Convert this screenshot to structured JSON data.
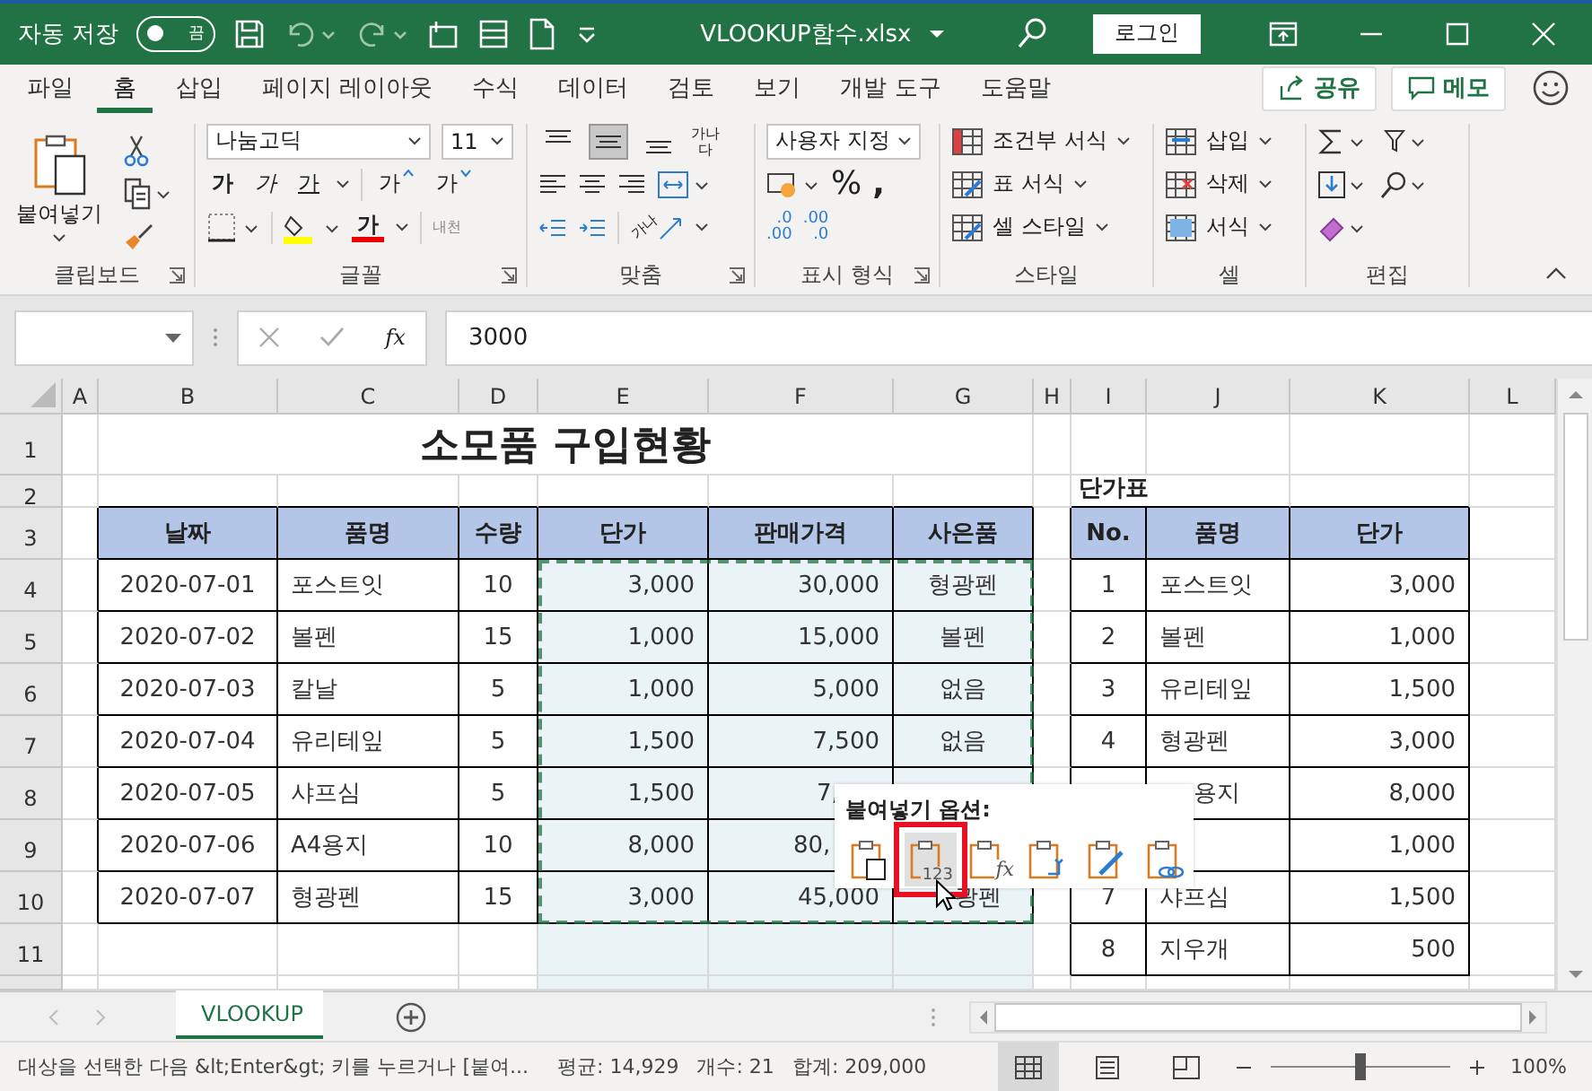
{
  "title_bar": {
    "autosave_label": "자동 저장",
    "autosave_state": "끔",
    "autosave_on": false,
    "file_name": "VLOOKUP함수.xlsx",
    "sign_in": "로그인"
  },
  "ribbon_tabs": [
    {
      "label": "파일",
      "selected": false
    },
    {
      "label": "홈",
      "selected": true
    },
    {
      "label": "삽입",
      "selected": false
    },
    {
      "label": "페이지 레이아웃",
      "selected": false
    },
    {
      "label": "수식",
      "selected": false
    },
    {
      "label": "데이터",
      "selected": false
    },
    {
      "label": "검토",
      "selected": false
    },
    {
      "label": "보기",
      "selected": false
    },
    {
      "label": "개발 도구",
      "selected": false
    },
    {
      "label": "도움말",
      "selected": false
    }
  ],
  "share": "공유",
  "comments": "메모",
  "ribbon": {
    "clipboard": {
      "paste": "붙여넣기",
      "label": "클립보드"
    },
    "font": {
      "font_name": "나눔고딕",
      "font_size": "11",
      "style_buttons": [
        {
          "kind": "bold",
          "glyph": "가"
        },
        {
          "kind": "italic",
          "glyph": "가"
        },
        {
          "kind": "underline",
          "glyph": "가"
        }
      ],
      "size_buttons": [
        {
          "kind": "grow",
          "glyph": "가"
        },
        {
          "kind": "shrink",
          "glyph": "가"
        }
      ],
      "font_color_glyph": "가",
      "phonetic_glyph": "내천",
      "label": "글꼴"
    },
    "alignment": {
      "vertical_buttons": [
        {
          "kind": "top",
          "selected": false
        },
        {
          "kind": "middle",
          "selected": true
        },
        {
          "kind": "bottom",
          "selected": false
        }
      ],
      "wrap_glyph": "가나다",
      "orientation_glyph": "가나",
      "label": "맞춤"
    },
    "number": {
      "format": "사용자 지정",
      "percent": "%",
      "comma": ",",
      "decimal_increase": [
        ".0",
        ".00"
      ],
      "decimal_decrease": [
        ".00",
        ".0"
      ],
      "label": "표시 형식"
    },
    "styles": {
      "items": [
        "조건부 서식",
        "표 서식",
        "셀 스타일"
      ],
      "label": "스타일"
    },
    "cells": {
      "items": [
        "삽입",
        "삭제",
        "서식"
      ],
      "label": "셀"
    },
    "editing": {
      "label": "편집"
    }
  },
  "formula_bar": {
    "function_symbol": "fx",
    "value": "3000"
  },
  "sheet": {
    "column_letters": [
      "A",
      "B",
      "C",
      "D",
      "E",
      "F",
      "G",
      "H",
      "I",
      "J",
      "K",
      "L"
    ],
    "row_numbers": [
      "1",
      "2",
      "3",
      "4",
      "5",
      "6",
      "7",
      "8",
      "9",
      "10",
      "11"
    ],
    "title": "소모품 구입현황",
    "price_caption": "단가표",
    "purchases": {
      "headers": [
        "날짜",
        "품명",
        "수량",
        "단가",
        "판매가격",
        "사은품"
      ],
      "rows": [
        [
          "2020-07-01",
          "포스트잇",
          "10",
          "3,000",
          "30,000",
          "형광펜"
        ],
        [
          "2020-07-02",
          "볼펜",
          "15",
          "1,000",
          "15,000",
          "볼펜"
        ],
        [
          "2020-07-03",
          "칼날",
          "5",
          "1,000",
          "5,000",
          "없음"
        ],
        [
          "2020-07-04",
          "유리테잎",
          "5",
          "1,500",
          "7,500",
          "없음"
        ],
        [
          "2020-07-05",
          "샤프심",
          "5",
          "1,500",
          "7,",
          null
        ],
        [
          "2020-07-06",
          "A4용지",
          "10",
          "8,000",
          "80,",
          null
        ],
        [
          "2020-07-07",
          "형광펜",
          "15",
          "3,000",
          "45,000",
          "광펜"
        ]
      ]
    },
    "prices": {
      "headers": [
        "No.",
        "품명",
        "단가"
      ],
      "rows": [
        [
          "1",
          "포스트잇",
          "3,000"
        ],
        [
          "2",
          "볼펜",
          "1,000"
        ],
        [
          "3",
          "유리테잎",
          "1,500"
        ],
        [
          "4",
          "형광펜",
          "3,000"
        ],
        [
          null,
          "용지",
          "8,000"
        ],
        [
          null,
          null,
          "1,000"
        ],
        [
          "7",
          "샤프심",
          "1,500"
        ],
        [
          "8",
          "지우개",
          "500"
        ]
      ]
    }
  },
  "paste_options": {
    "title": "붙여넣기 옵션:",
    "options": [
      {
        "kind": "paste",
        "selected": false
      },
      {
        "kind": "values",
        "label": "123",
        "selected": true
      },
      {
        "kind": "formulas",
        "label": "fx",
        "selected": false
      },
      {
        "kind": "transpose",
        "selected": false
      },
      {
        "kind": "formatting",
        "selected": false
      },
      {
        "kind": "link",
        "selected": false
      }
    ]
  },
  "sheet_tabs": [
    {
      "label": "VLOOKUP",
      "selected": true
    }
  ],
  "status_bar": {
    "message": "대상을 선택한 다음 &lt;Enter&gt; 키를 누르거나 [붙여...",
    "stats": [
      "평균: 14,929",
      "개수: 21",
      "합계: 209,000"
    ],
    "views": [
      {
        "kind": "normal",
        "selected": true
      },
      {
        "kind": "page_layout",
        "selected": false
      },
      {
        "kind": "page_break",
        "selected": false
      }
    ],
    "zoom": {
      "level": 0.5,
      "reading": "100%"
    }
  }
}
